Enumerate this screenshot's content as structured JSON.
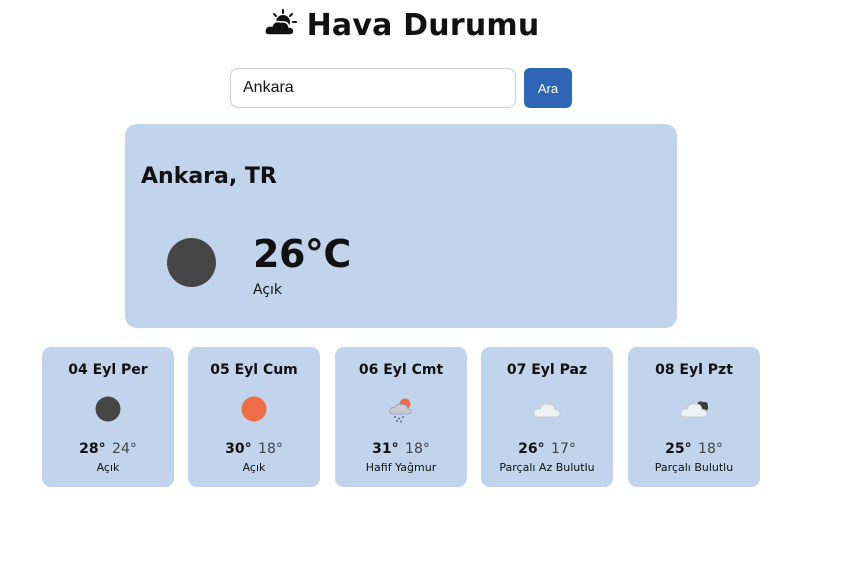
{
  "header": {
    "title": "Hava Durumu",
    "icon": "sun-behind-cloud-icon"
  },
  "search": {
    "value": "Ankara",
    "button_label": "Ara"
  },
  "current": {
    "city": "Ankara, TR",
    "temperature": "26°C",
    "description": "Açık",
    "icon": "clear-moon-icon",
    "icon_color": "#454545"
  },
  "forecast": [
    {
      "day": "04 Eyl Per",
      "max": "28°",
      "min": "24°",
      "description": "Açık",
      "icon": "clear-moon-icon"
    },
    {
      "day": "05 Eyl Cum",
      "max": "30°",
      "min": "18°",
      "description": "Açık",
      "icon": "clear-sun-icon"
    },
    {
      "day": "06 Eyl Cmt",
      "max": "31°",
      "min": "18°",
      "description": "Hafif Yağmur",
      "icon": "light-rain-icon"
    },
    {
      "day": "07 Eyl Paz",
      "max": "26°",
      "min": "17°",
      "description": "Parçalı Az Bulutlu",
      "icon": "cloud-icon"
    },
    {
      "day": "08 Eyl Pzt",
      "max": "25°",
      "min": "18°",
      "description": "Parçalı Bulutlu",
      "icon": "cloud-night-icon"
    }
  ],
  "colors": {
    "card_bg": "#c2d3ec",
    "button": "#2f65b5",
    "sun": "#ee6e4a",
    "moon": "#454545"
  }
}
